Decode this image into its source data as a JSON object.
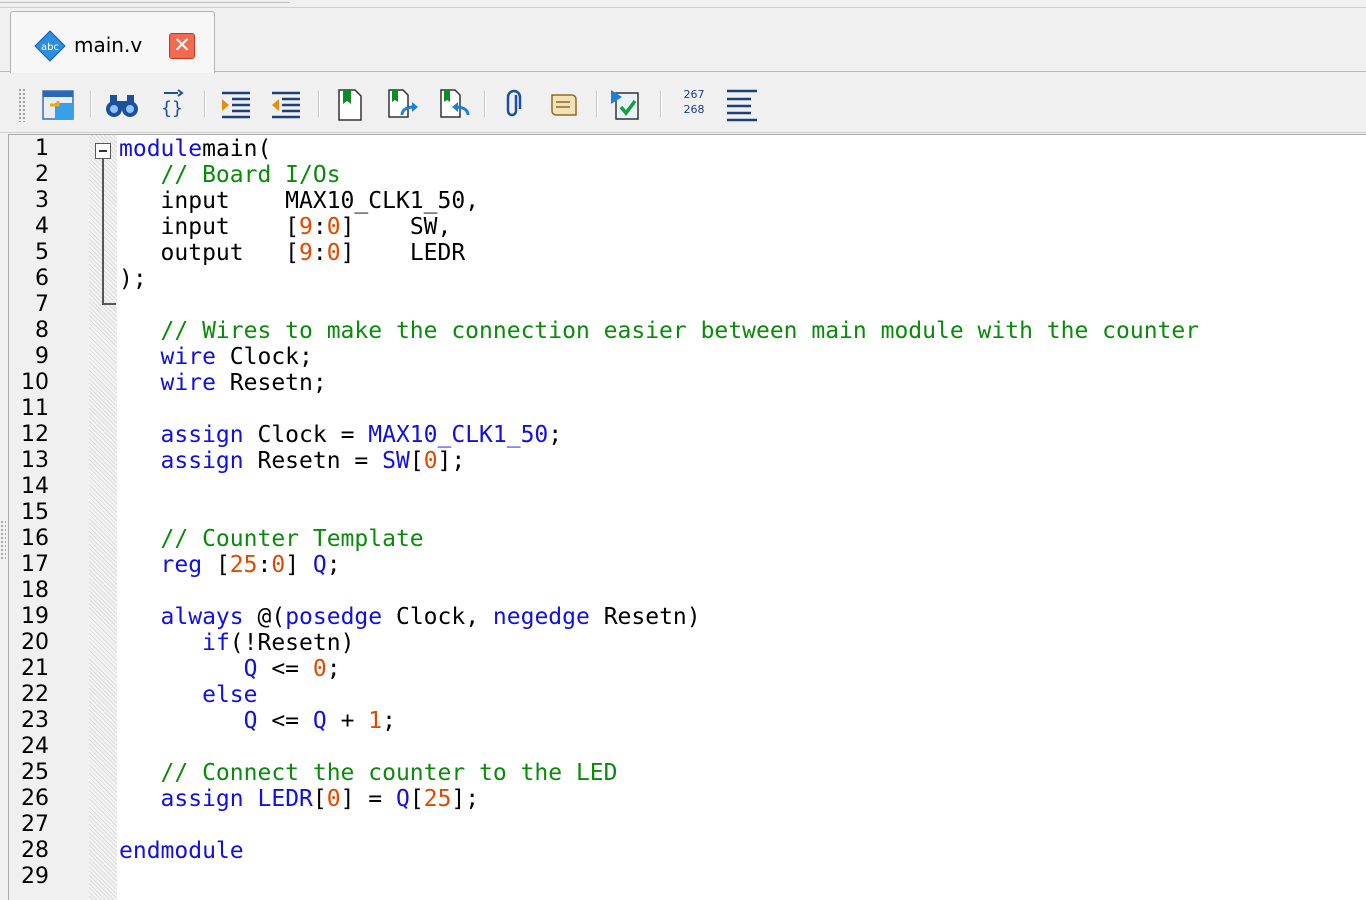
{
  "tab": {
    "title": "main.v",
    "close_glyph": "✕",
    "icon_text": "abc",
    "icon": "verilog-file-icon"
  },
  "toolbar": {
    "buttons": [
      "window-layout-icon",
      "find-binoculars-icon",
      "brace-match-icon",
      "indent-icon",
      "unindent-icon",
      "bookmark-icon",
      "next-bookmark-icon",
      "previous-bookmark-icon",
      "attach-icon",
      "template-scroll-icon",
      "insert-template-icon",
      "line-numbers-icon",
      "word-wrap-icon"
    ],
    "line_numbers_label_top": "267",
    "line_numbers_label_bottom": "268"
  },
  "editor": {
    "line_numbers": [
      "1",
      "2",
      "3",
      "4",
      "5",
      "6",
      "7",
      "8",
      "9",
      "10",
      "11",
      "12",
      "13",
      "14",
      "15",
      "16",
      "17",
      "18",
      "19",
      "20",
      "21",
      "22",
      "23",
      "24",
      "25",
      "26",
      "27",
      "28",
      "29"
    ],
    "code": [
      [
        [
          "kw",
          "module"
        ],
        [
          "",
          "main("
        ]
      ],
      [
        [
          "",
          "   "
        ],
        [
          "cm",
          "// Board I/Os"
        ]
      ],
      [
        [
          "",
          "   input    MAX10_CLK1_50,"
        ]
      ],
      [
        [
          "",
          "   input    ["
        ],
        [
          "nm",
          "9"
        ],
        [
          "",
          ":"
        ],
        [
          "nm",
          "0"
        ],
        [
          "",
          "]    SW,"
        ]
      ],
      [
        [
          "",
          "   output   ["
        ],
        [
          "nm",
          "9"
        ],
        [
          "",
          ":"
        ],
        [
          "nm",
          "0"
        ],
        [
          "",
          "]    LEDR"
        ]
      ],
      [
        [
          "",
          ");"
        ]
      ],
      [
        [
          "",
          ""
        ]
      ],
      [
        [
          "",
          "   "
        ],
        [
          "cm",
          "// Wires to make the connection easier between main module with the counter"
        ]
      ],
      [
        [
          "",
          "   "
        ],
        [
          "kw",
          "wire"
        ],
        [
          "",
          " Clock;"
        ]
      ],
      [
        [
          "",
          "   "
        ],
        [
          "kw",
          "wire"
        ],
        [
          "",
          " Resetn;"
        ]
      ],
      [
        [
          "",
          ""
        ]
      ],
      [
        [
          "",
          "   "
        ],
        [
          "kw",
          "assign"
        ],
        [
          "",
          " Clock = "
        ],
        [
          "kw",
          "MAX10_CLK1_50"
        ],
        [
          "",
          ";"
        ]
      ],
      [
        [
          "",
          "   "
        ],
        [
          "kw",
          "assign"
        ],
        [
          "",
          " Resetn = "
        ],
        [
          "kw",
          "SW"
        ],
        [
          "",
          "["
        ],
        [
          "nm",
          "0"
        ],
        [
          "",
          "];"
        ]
      ],
      [
        [
          "",
          ""
        ]
      ],
      [
        [
          "",
          ""
        ]
      ],
      [
        [
          "",
          "   "
        ],
        [
          "cm",
          "// Counter Template"
        ]
      ],
      [
        [
          "",
          "   "
        ],
        [
          "kw",
          "reg"
        ],
        [
          "",
          " ["
        ],
        [
          "nm",
          "25"
        ],
        [
          "",
          ":"
        ],
        [
          "nm",
          "0"
        ],
        [
          "",
          "] "
        ],
        [
          "kw",
          "Q"
        ],
        [
          "",
          ";"
        ]
      ],
      [
        [
          "",
          ""
        ]
      ],
      [
        [
          "",
          "   "
        ],
        [
          "kw",
          "always"
        ],
        [
          "",
          " @("
        ],
        [
          "kw",
          "posedge"
        ],
        [
          "",
          " Clock, "
        ],
        [
          "kw",
          "negedge"
        ],
        [
          "",
          " Resetn)"
        ]
      ],
      [
        [
          "",
          "      "
        ],
        [
          "kw",
          "if"
        ],
        [
          "",
          "(!Resetn)"
        ]
      ],
      [
        [
          "",
          "         "
        ],
        [
          "kw",
          "Q"
        ],
        [
          "",
          " <= "
        ],
        [
          "nm",
          "0"
        ],
        [
          "",
          ";"
        ]
      ],
      [
        [
          "",
          "      "
        ],
        [
          "kw",
          "else"
        ]
      ],
      [
        [
          "",
          "         "
        ],
        [
          "kw",
          "Q"
        ],
        [
          "",
          " <= "
        ],
        [
          "kw",
          "Q"
        ],
        [
          "",
          " + "
        ],
        [
          "nm",
          "1"
        ],
        [
          "",
          ";"
        ]
      ],
      [
        [
          "",
          ""
        ]
      ],
      [
        [
          "",
          "   "
        ],
        [
          "cm",
          "// Connect the counter to the LED"
        ]
      ],
      [
        [
          "",
          "   "
        ],
        [
          "kw",
          "assign"
        ],
        [
          "",
          " "
        ],
        [
          "kw",
          "LEDR"
        ],
        [
          "",
          "["
        ],
        [
          "nm",
          "0"
        ],
        [
          "",
          "] = "
        ],
        [
          "kw",
          "Q"
        ],
        [
          "",
          "["
        ],
        [
          "nm",
          "25"
        ],
        [
          "",
          "];"
        ]
      ],
      [
        [
          "",
          ""
        ]
      ],
      [
        [
          "kw",
          "endmodule"
        ]
      ],
      [
        [
          "",
          ""
        ]
      ]
    ]
  }
}
